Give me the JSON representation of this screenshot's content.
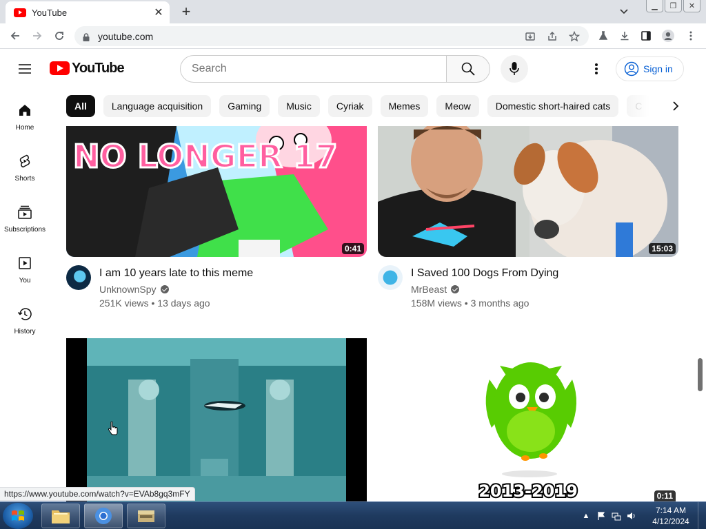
{
  "browser": {
    "tab_title": "YouTube",
    "url": "youtube.com",
    "status_url": "https://www.youtube.com/watch?v=EVAb8gq3mFY"
  },
  "youtube": {
    "logo_text": "YouTube",
    "search_placeholder": "Search",
    "sign_in": "Sign in",
    "chips": [
      "All",
      "Language acquisition",
      "Gaming",
      "Music",
      "Cyriak",
      "Memes",
      "Meow",
      "Domestic short-haired cats",
      "C"
    ],
    "guide": [
      "Home",
      "Shorts",
      "Subscriptions",
      "You",
      "History"
    ],
    "videos": [
      {
        "title": "I am 10 years late to this meme",
        "channel": "UnknownSpy",
        "views": "251K views",
        "age": "13 days ago",
        "duration": "0:41",
        "thumb_text": "NO LONGER 17"
      },
      {
        "title": "I Saved 100 Dogs From Dying",
        "channel": "MrBeast",
        "views": "158M views",
        "age": "3 months ago",
        "duration": "15:03"
      },
      {
        "duration": ""
      },
      {
        "duration": "0:11",
        "thumb_text": "2013-2019"
      }
    ]
  },
  "taskbar": {
    "time": "7:14 AM",
    "date": "4/12/2024"
  },
  "colors": {
    "brand_red": "#ff0000",
    "link_blue": "#065fd4",
    "chip_bg": "#f2f2f2",
    "owl_green": "#58cc02"
  }
}
